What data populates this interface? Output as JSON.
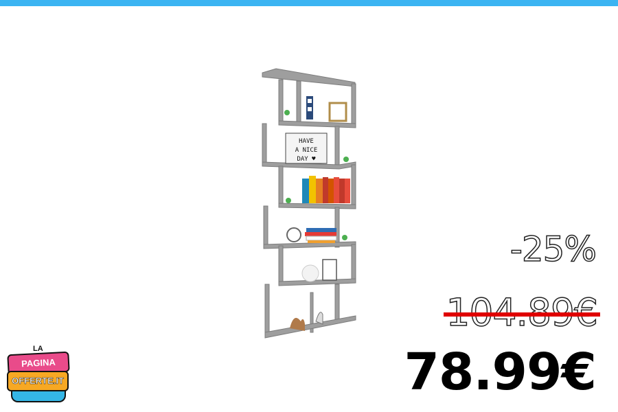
{
  "product": {
    "image_icon": "bookshelf-image",
    "lightbox_text": [
      "HAVE",
      "A NICE",
      "DAY ♥"
    ]
  },
  "pricing": {
    "discount": "-25%",
    "old_price": "104.89€",
    "new_price": "78.99€"
  },
  "logo": {
    "small": "LA",
    "line1": "PAGINA DELLE",
    "line2": "OFFERTE.IT"
  },
  "colors": {
    "top_bar": "#3bb4f2",
    "strike": "#e00000",
    "shelf": "#9a9a9a"
  }
}
